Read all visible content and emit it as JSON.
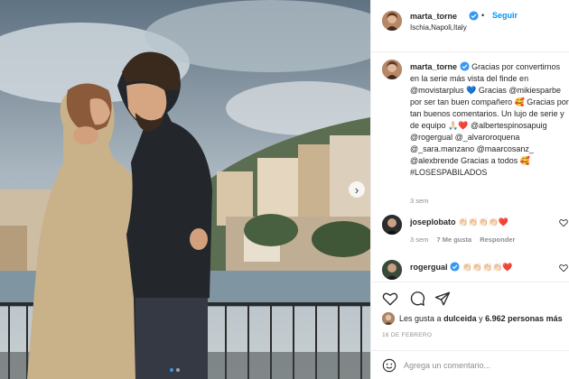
{
  "post": {
    "author": "marta_torne",
    "follow_label": "Seguir",
    "separator": "•",
    "location": "Ischia,Napoli,Italy",
    "next_arrow": "›"
  },
  "caption": {
    "user": "marta_torne",
    "text": "Gracias por convertirnos en la serie más vista del finde en @movistarplus 💙 Gracias @mikiesparbe por ser tan buen compañero 🥰 Gracias por tan buenos comentarios. Un lujo de serie y de equipo 🙏🏻❤️ @albertespinosapuig @rogergual @_alvaroroquena @_sara.manzano @maarcosanz_ @alexbrende Gracias a todos 🥰 #LOSESPABILADOS",
    "time": "3 sem"
  },
  "comments": [
    {
      "user": "joseplobato",
      "text": "👏🏻👏🏻👏🏻👏🏻❤️",
      "time": "3 sem",
      "likes": "7 Me gusta",
      "reply": "Responder"
    },
    {
      "user": "rogergual",
      "text": "👏🏻👏🏻👏🏻👏🏻❤️"
    }
  ],
  "likes": {
    "prefix": "Les gusta a",
    "user": "dulceida",
    "connector": "y",
    "others": "6.962 personas más"
  },
  "date": "16 DE FEBRERO",
  "comment_box": {
    "placeholder": "Agrega un comentario..."
  },
  "colors": {
    "accent": "#0095f6",
    "verified": "#3897f0",
    "text": "#262626",
    "muted": "#8e8e8e"
  }
}
